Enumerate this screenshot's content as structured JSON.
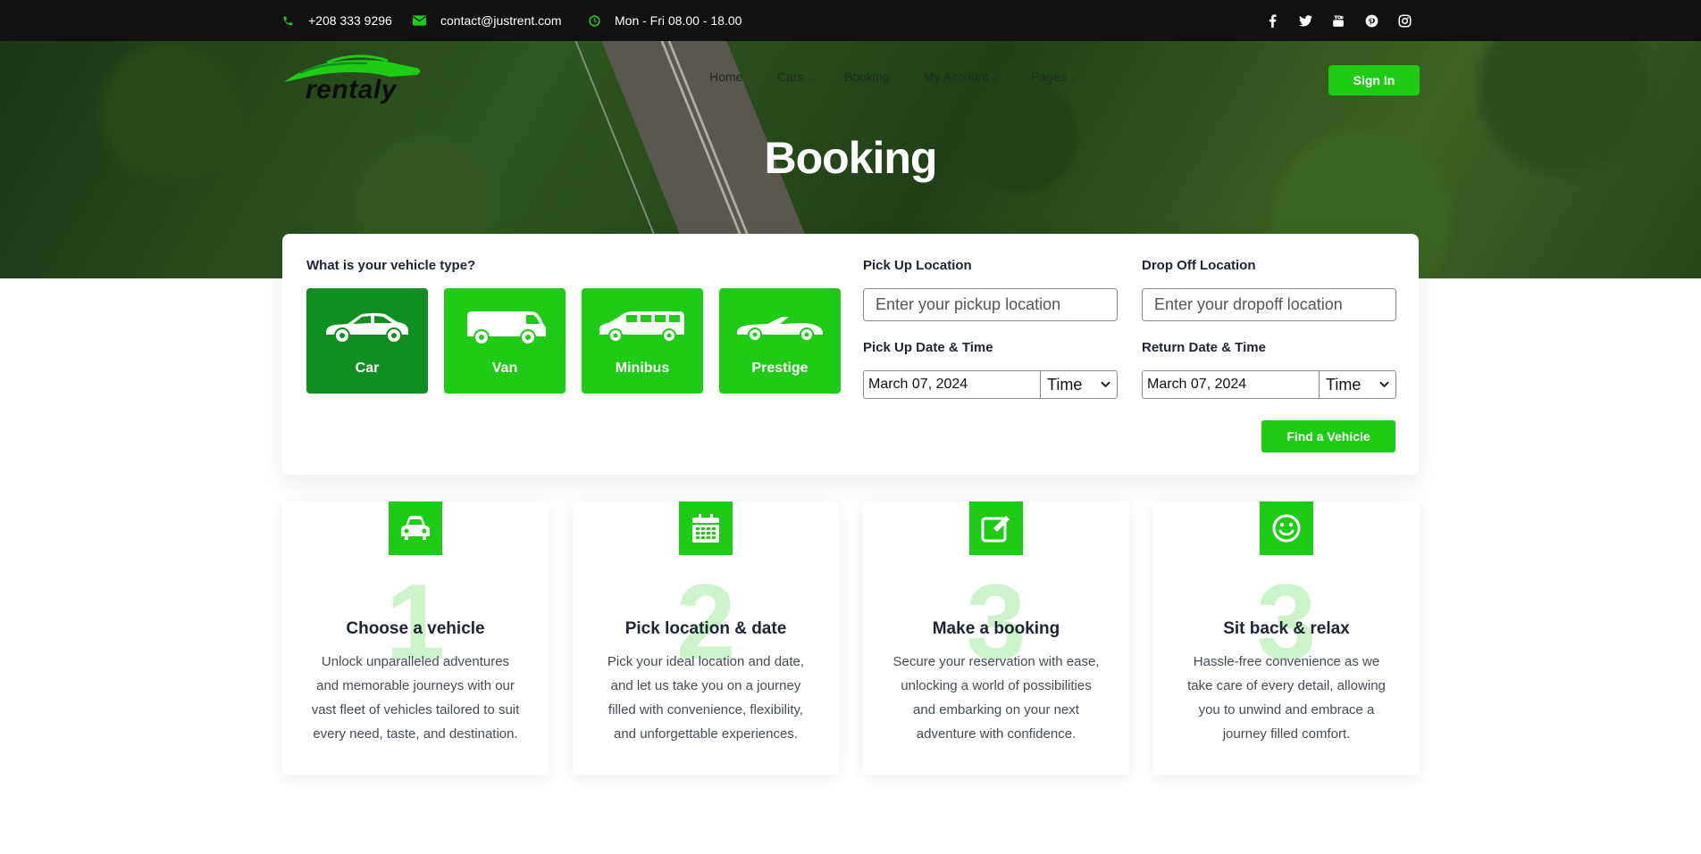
{
  "topbar": {
    "phone": "+208 333 9296",
    "email": "contact@justrent.com",
    "hours": "Mon - Fri 08.00 - 18.00",
    "social_icons": [
      "facebook-icon",
      "twitter-icon",
      "youtube-icon",
      "pinterest-icon",
      "instagram-icon"
    ]
  },
  "header": {
    "logo_text": "rentaly",
    "nav": [
      "Home",
      "Cars",
      "Booking",
      "My Account",
      "Pages"
    ],
    "signin_label": "Sign In"
  },
  "hero": {
    "title": "Booking"
  },
  "booking": {
    "vehicle_type_label": "What is your vehicle type?",
    "vehicle_types": [
      "Car",
      "Van",
      "Minibus",
      "Prestige"
    ],
    "selected_vehicle": "Car",
    "pickup_location_label": "Pick Up Location",
    "pickup_placeholder": "Enter your pickup location",
    "dropoff_location_label": "Drop Off Location",
    "dropoff_placeholder": "Enter your dropoff location",
    "pickup_datetime_label": "Pick Up Date & Time",
    "pickup_date": "March 07, 2024",
    "pickup_time": "Time",
    "return_datetime_label": "Return Date & Time",
    "return_date": "March 07, 2024",
    "return_time": "Time",
    "find_label": "Find a Vehicle"
  },
  "features": [
    {
      "number": "1",
      "title": "Choose a vehicle",
      "lines": [
        "Unlock unparalleled adventures",
        "and memorable journeys with our",
        "vast fleet of vehicles tailored to suit",
        "every need, taste, and destination."
      ]
    },
    {
      "number": "2",
      "title": "Pick location & date",
      "lines": [
        "Pick your ideal location and date,",
        "and let us take you on a journey",
        "filled with convenience, flexibility,",
        "and unforgettable experiences."
      ]
    },
    {
      "number": "3",
      "title": "Make a booking",
      "lines": [
        "Secure your reservation with ease,",
        "unlocking a world of possibilities",
        "and embarking on your next",
        "adventure with confidence."
      ]
    },
    {
      "number": "3",
      "title": "Sit back & relax",
      "lines": [
        "Hassle-free convenience as we",
        "take care of every detail, allowing",
        "you to unwind and embrace a",
        "journey filled comfort."
      ]
    }
  ],
  "colors": {
    "accent": "#1ecb15",
    "accent_dark": "#0f8f1f",
    "topbar": "#111111"
  }
}
